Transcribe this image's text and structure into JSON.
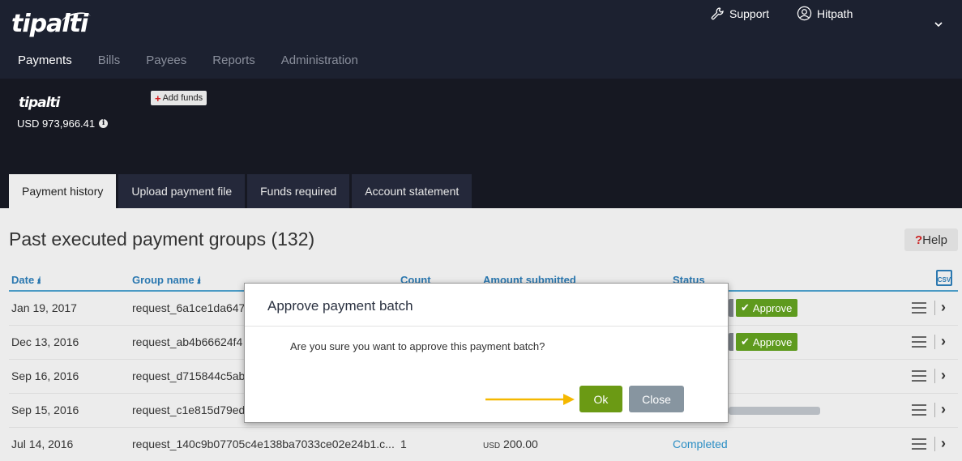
{
  "header": {
    "logo_text": "tipalti",
    "support_label": "Support",
    "user_label": "Hitpath",
    "nav": [
      "Payments",
      "Bills",
      "Payees",
      "Reports",
      "Administration"
    ]
  },
  "account": {
    "mini_logo": "tipalti",
    "balance": "USD 973,966.41",
    "add_funds_label": "Add funds"
  },
  "tabs": [
    "Payment history",
    "Upload payment file",
    "Funds required",
    "Account statement"
  ],
  "page": {
    "title": "Past executed payment groups (132)",
    "help_label": "Help",
    "csv_label": "CSV"
  },
  "table": {
    "headers": {
      "date": "Date",
      "group_name": "Group name",
      "count": "Count",
      "amount": "Amount submitted",
      "status": "Status"
    },
    "rows": [
      {
        "date": "Jan 19, 2017",
        "group": "request_6a1ce1da647",
        "count": "",
        "currency": "",
        "amount": "",
        "status": "",
        "action": "Approve"
      },
      {
        "date": "Dec 13, 2016",
        "group": "request_ab4b66624f4",
        "count": "",
        "currency": "",
        "amount": "",
        "status": "",
        "action": "Approve"
      },
      {
        "date": "Sep 16, 2016",
        "group": "request_d715844c5ab",
        "count": "",
        "currency": "",
        "amount": "",
        "status": "",
        "action": ""
      },
      {
        "date": "Sep 15, 2016",
        "group": "request_c1e815d79ed",
        "count": "",
        "currency": "",
        "amount": "",
        "status": "",
        "action": ""
      },
      {
        "date": "Jul 14, 2016",
        "group": "request_140c9b07705c4e138ba7033ce02e24b1.c...",
        "count": "1",
        "currency": "USD",
        "amount": "200.00",
        "status": "Completed",
        "action": ""
      }
    ]
  },
  "modal": {
    "title": "Approve payment batch",
    "message": "Are you sure you want to approve this payment batch?",
    "ok_label": "Ok",
    "close_label": "Close"
  },
  "colors": {
    "accent": "#e5a823",
    "ok_button": "#6b9a14",
    "approve": "#5e9a1e",
    "link": "#2b78b0",
    "arrow": "#f5b800"
  }
}
